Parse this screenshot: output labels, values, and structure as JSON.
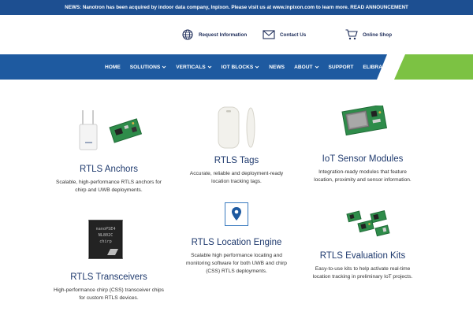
{
  "news_bar": {
    "text": "NEWS: Nanotron has been acquired by indoor data company, Inpixon. Please visit us at www.inpixon.com to learn more. READ ANNOUNCEMENT"
  },
  "header_links": {
    "request_info": "Request Information",
    "contact": "Contact Us",
    "shop": "Online Shop"
  },
  "nav": {
    "items": [
      "HOME",
      "SOLUTIONS",
      "VERTICALS",
      "IOT BLOCKS",
      "NEWS",
      "ABOUT",
      "SUPPORT",
      "ELIBRARY"
    ]
  },
  "products": [
    {
      "title": "RTLS Anchors",
      "desc": "Scalable, high-performance RTLS anchors for chirp and UWB deployments."
    },
    {
      "title": "RTLS Tags",
      "desc": "Accurate, reliable and deployment-ready location tracking tags."
    },
    {
      "title": "IoT Sensor Modules",
      "desc": "Integration-ready modules that feature location, proximity and sensor information."
    },
    {
      "title": "RTLS Transceivers",
      "desc": "High-performance chirp (CSS) transceiver chips for custom RTLS devices."
    },
    {
      "title": "RTLS Location Engine",
      "desc": "Scalable high performance locating and monitoring software for both UWB and chirp (CSS) RTLS deployments."
    },
    {
      "title": "RTLS Evaluation Kits",
      "desc": "Easy-to-use kits to help activate real-time location tracking in preliminary IoT projects."
    }
  ],
  "chip_marking": [
    "nanoPSE4",
    "NL802C",
    "chirp"
  ],
  "colors": {
    "news_bg": "#1d4f91",
    "nav_blue": "#1e5aa0",
    "nav_green": "#7cc243",
    "title_blue": "#1f3a6e"
  }
}
